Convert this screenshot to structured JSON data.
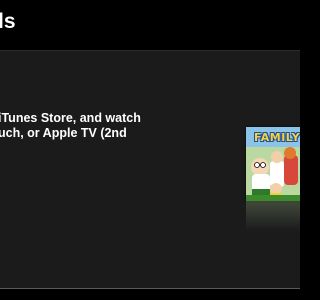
{
  "header": {
    "title": "ls"
  },
  "description": {
    "line1": "iTunes Store, and watch",
    "line2": "uch, or Apple TV (2nd"
  },
  "cover": {
    "logo_text": "FAMILY",
    "accent_color": "#f7d33a",
    "outline_color": "#1e4f9c"
  },
  "colors": {
    "background": "#000000",
    "panel": "#1b1b1b",
    "text": "#ffffff"
  }
}
